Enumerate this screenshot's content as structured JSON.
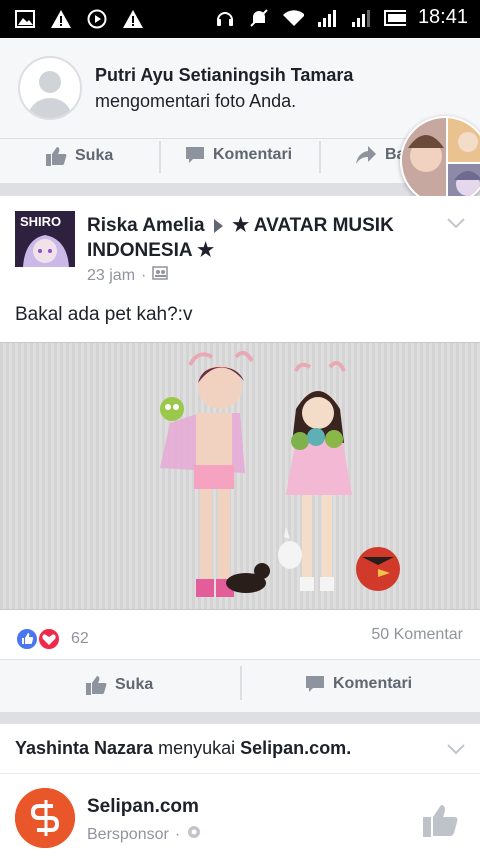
{
  "status_bar": {
    "time": "18:41"
  },
  "notification": {
    "name": "Putri Ayu Setianingsih Tamara",
    "text": "mengomentari foto Anda.",
    "actions": {
      "like": "Suka",
      "comment": "Komentari",
      "share": "Bag"
    }
  },
  "post": {
    "author": "Riska Amelia",
    "group": "★ AVATAR MUSIK INDONESIA ★",
    "time": "23 jam",
    "text": "Bakal ada pet kah?:v",
    "avatar_text": "SHIRO",
    "reactions_count": "62",
    "comments_count": "50 Komentar",
    "actions": {
      "like": "Suka",
      "comment": "Komentari"
    }
  },
  "liked_page": {
    "user": "Yashinta Nazara",
    "verb": "menyukai",
    "page": "Selipan.com.",
    "page_name": "Selipan.com",
    "sponsored": "Bersponsor"
  },
  "colors": {
    "like_blue": "#4a76f2",
    "love_red": "#f0284a",
    "text": "#1d2129",
    "muted": "#90949c"
  }
}
